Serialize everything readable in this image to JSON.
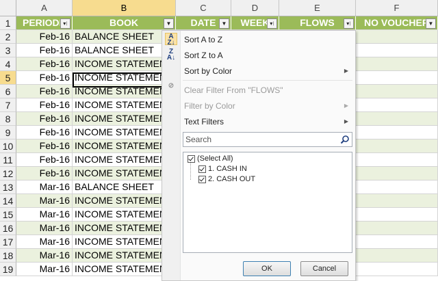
{
  "columns": [
    "A",
    "B",
    "C",
    "D",
    "E",
    "F"
  ],
  "selected_column": "B",
  "rows": [
    "1",
    "2",
    "3",
    "4",
    "5",
    "6",
    "7",
    "8",
    "9",
    "10",
    "11",
    "12",
    "13",
    "14",
    "15",
    "16",
    "17",
    "18",
    "19"
  ],
  "selected_row": "5",
  "header_row": {
    "A": "PERIODE",
    "B": "BOOK",
    "C": "DATE",
    "D": "WEEK",
    "E": "FLOWS",
    "F": "NO VOUCHER"
  },
  "data_rows": [
    {
      "periode": "Feb-16",
      "book": "BALANCE SHEET"
    },
    {
      "periode": "Feb-16",
      "book": "BALANCE SHEET"
    },
    {
      "periode": "Feb-16",
      "book": "INCOME STATEMEN"
    },
    {
      "periode": "Feb-16",
      "book": "INCOME STATEMEN"
    },
    {
      "periode": "Feb-16",
      "book": "INCOME STATEMEN"
    },
    {
      "periode": "Feb-16",
      "book": "INCOME STATEMEN"
    },
    {
      "periode": "Feb-16",
      "book": "INCOME STATEMEN"
    },
    {
      "periode": "Feb-16",
      "book": "INCOME STATEMEN"
    },
    {
      "periode": "Feb-16",
      "book": "INCOME STATEMEN"
    },
    {
      "periode": "Feb-16",
      "book": "INCOME STATEMEN"
    },
    {
      "periode": "Feb-16",
      "book": "INCOME STATEMEN"
    },
    {
      "periode": "Mar-16",
      "book": "BALANCE SHEET"
    },
    {
      "periode": "Mar-16",
      "book": "INCOME STATEMEN"
    },
    {
      "periode": "Mar-16",
      "book": "INCOME STATEMEN"
    },
    {
      "periode": "Mar-16",
      "book": "INCOME STATEMEN"
    },
    {
      "periode": "Mar-16",
      "book": "INCOME STATEMEN"
    },
    {
      "periode": "Mar-16",
      "book": "INCOME STATEMEN"
    },
    {
      "periode": "Mar-16",
      "book": "INCOME STATEMEN"
    }
  ],
  "filter_menu": {
    "sort_a_z": "Sort A to Z",
    "sort_z_a": "Sort Z to A",
    "sort_by_color": "Sort by Color",
    "clear_filter": "Clear Filter From \"FLOWS\"",
    "filter_by_color": "Filter by Color",
    "text_filters": "Text Filters",
    "search_placeholder": "Search",
    "items": [
      "(Select All)",
      "1. CASH IN",
      "2. CASH OUT"
    ],
    "ok_label": "OK",
    "cancel_label": "Cancel"
  },
  "colors": {
    "header_green": "#9bbb59",
    "band_green": "#ebf1de",
    "selected_header": "#f7dc8f"
  },
  "icons": [
    "sort-ascending-icon",
    "sort-descending-icon",
    "clear-filter-icon",
    "search-icon",
    "filter-dropdown-icon",
    "filter-active-icon",
    "submenu-arrow-icon"
  ]
}
